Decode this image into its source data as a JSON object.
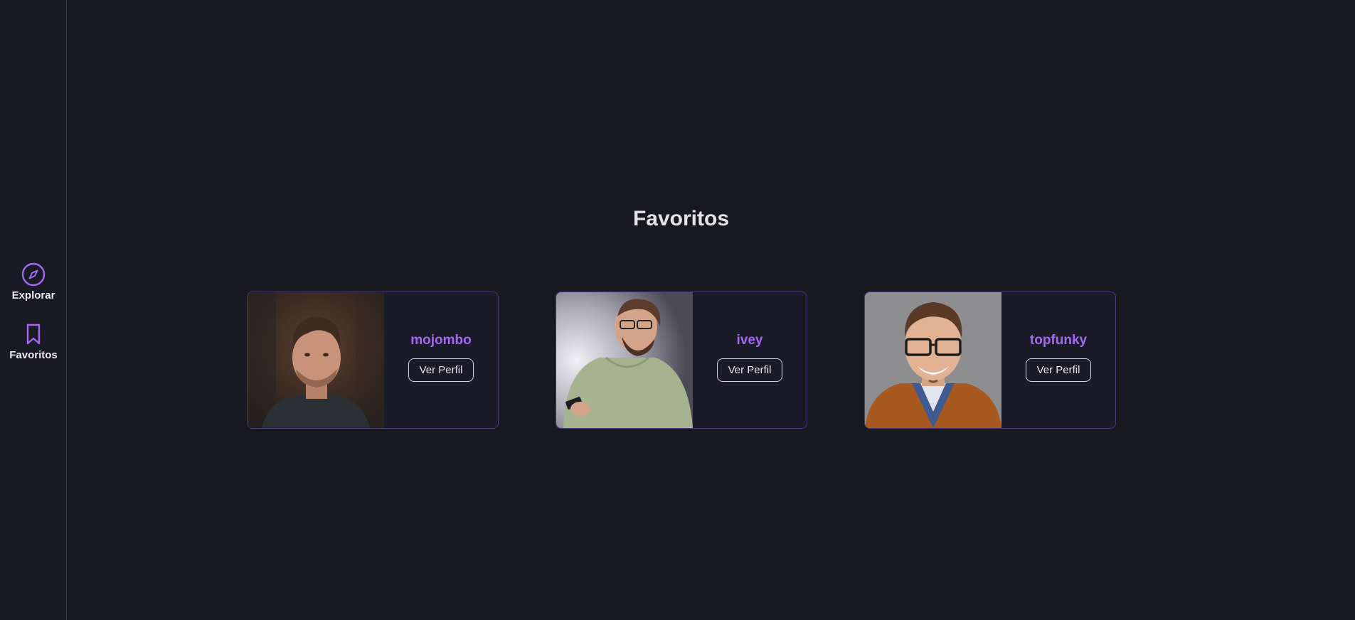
{
  "sidebar": {
    "items": [
      {
        "label": "Explorar",
        "icon": "compass-icon"
      },
      {
        "label": "Favoritos",
        "icon": "bookmark-icon"
      }
    ]
  },
  "main": {
    "title": "Favoritos",
    "cards": [
      {
        "username": "mojombo",
        "button_label": "Ver Perfil"
      },
      {
        "username": "ivey",
        "button_label": "Ver Perfil"
      },
      {
        "username": "topfunky",
        "button_label": "Ver Perfil"
      }
    ]
  },
  "colors": {
    "background": "#18181f",
    "sidebar": "#191a25",
    "accent": "#a368f0",
    "card_border": "#4a3a78"
  }
}
